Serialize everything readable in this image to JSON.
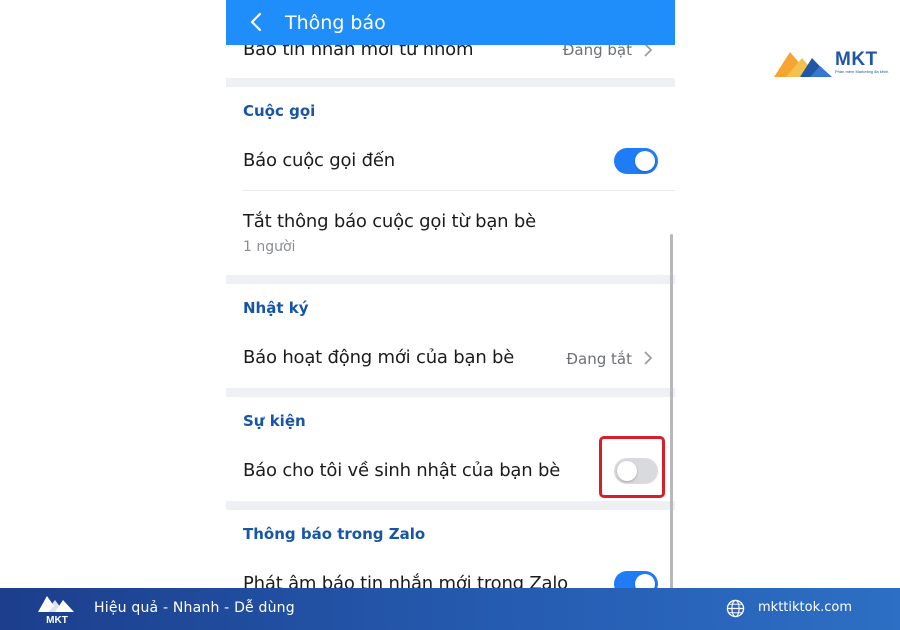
{
  "topbar": {
    "title": "Thông báo",
    "back_icon": "chevron-left-icon"
  },
  "rows": {
    "group_messages": {
      "label": "Báo tin nhắn mới từ nhóm",
      "value": "Đang bật"
    },
    "incoming_call": {
      "label": "Báo cuộc gọi đến",
      "toggle": true
    },
    "mute_friend_calls": {
      "label": "Tắt thông báo cuộc gọi từ bạn bè",
      "sub": "1 người"
    },
    "friend_activity": {
      "label": "Báo hoạt động mới của bạn bè",
      "value": "Đang tắt"
    },
    "birthday": {
      "label": "Báo cho tôi về sinh nhật của bạn bè",
      "toggle": false
    },
    "sound_new_message": {
      "label": "Phát âm báo tin nhắn mới trong Zalo",
      "toggle": true
    }
  },
  "sections": {
    "calls": "Cuộc gọi",
    "diary": "Nhật ký",
    "events": "Sự kiện",
    "in_app": "Thông báo trong Zalo"
  },
  "brand": {
    "name": "MKT",
    "tagline": "Phần mềm Marketing đa kênh"
  },
  "footer": {
    "slogan": "Hiệu quả - Nhanh - Dễ dùng",
    "website": "mkttiktok.com",
    "globe_icon": "globe-icon"
  },
  "colors": {
    "header_blue": "#1f8efa",
    "toggle_on": "#1f7cf7",
    "section_header": "#1755a7",
    "highlight": "#d71e2a",
    "footer": "#255bb0"
  }
}
